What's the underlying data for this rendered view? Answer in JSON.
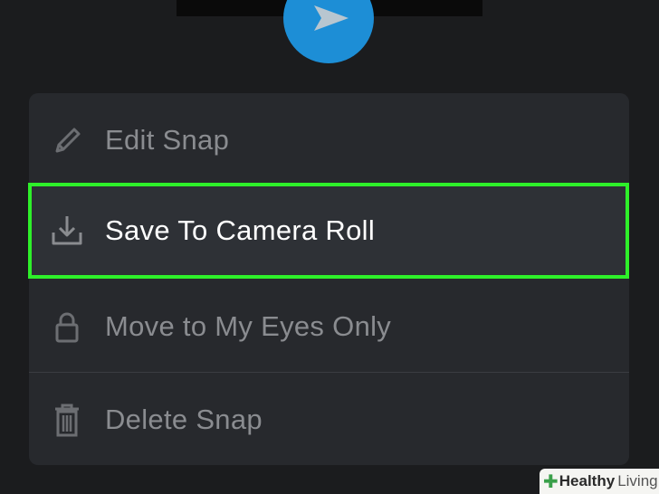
{
  "header": {
    "send_button_icon": "play-arrow-icon"
  },
  "menu": {
    "items": [
      {
        "label": "Edit Snap",
        "icon": "pencil-icon"
      },
      {
        "label": "Save To Camera Roll",
        "icon": "download-icon",
        "highlighted": true
      },
      {
        "label": "Move to My Eyes Only",
        "icon": "lock-icon"
      },
      {
        "label": "Delete Snap",
        "icon": "trash-icon"
      }
    ]
  },
  "colors": {
    "background": "#1b1c1e",
    "menu_background": "#27292d",
    "send_button": "#1d8ed6",
    "highlight_border": "#2ef02a",
    "label_text": "#8a8c90",
    "highlight_label_text": "#ffffff"
  },
  "watermark": {
    "brand_part1": "Healthy",
    "brand_part2": "Living"
  }
}
